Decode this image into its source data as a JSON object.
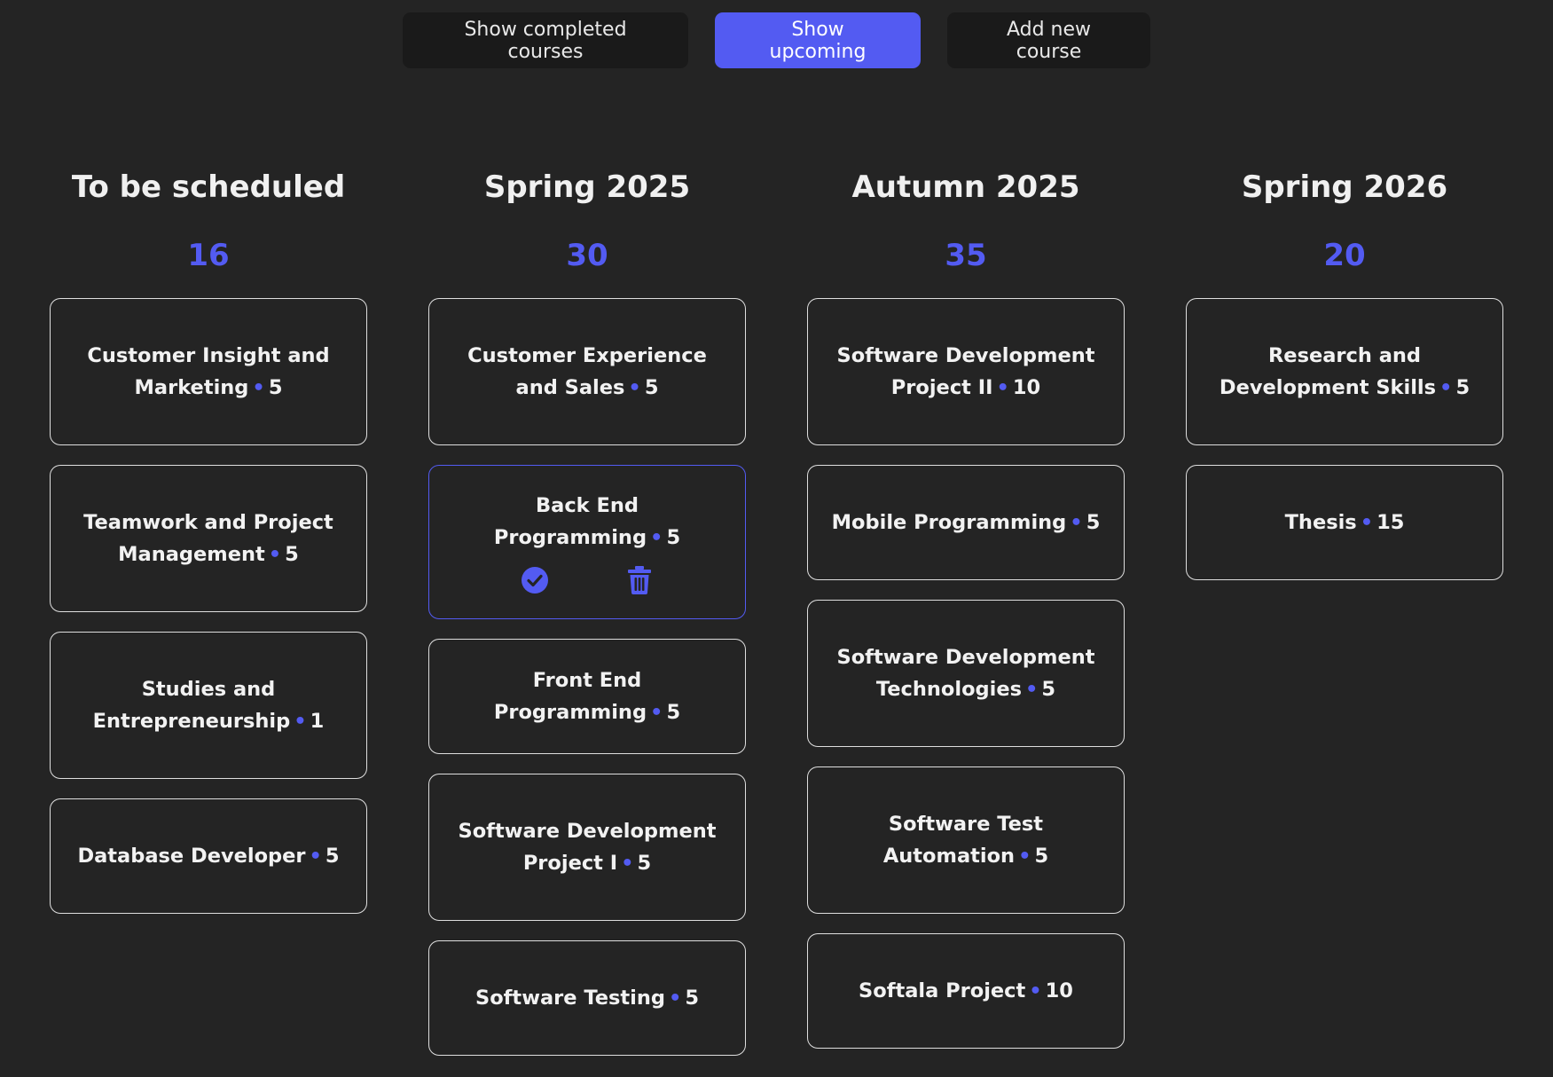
{
  "toolbar": {
    "completed_label": "Show completed courses",
    "upcoming_label": "Show upcoming",
    "add_label": "Add new course"
  },
  "colors": {
    "background": "#242424",
    "accent": "#535bf2",
    "button_bg": "#1a1a1a"
  },
  "columns": [
    {
      "title": "To be scheduled",
      "credits": "16",
      "courses": [
        {
          "name": "Customer Insight and Marketing",
          "credits": "5"
        },
        {
          "name": "Teamwork and Project Management",
          "credits": "5"
        },
        {
          "name": "Studies and Entrepreneurship",
          "credits": "1"
        },
        {
          "name": "Database Developer",
          "credits": "5"
        }
      ]
    },
    {
      "title": "Spring 2025",
      "credits": "30",
      "courses": [
        {
          "name": "Customer Experience and Sales",
          "credits": "5"
        },
        {
          "name": "Back End Programming",
          "credits": "5"
        },
        {
          "name": "Front End Programming",
          "credits": "5"
        },
        {
          "name": "Software Development Project I",
          "credits": "5"
        },
        {
          "name": "Software Testing",
          "credits": "5"
        }
      ]
    },
    {
      "title": "Autumn 2025",
      "credits": "35",
      "courses": [
        {
          "name": "Software Development Project II",
          "credits": "10"
        },
        {
          "name": "Mobile Programming",
          "credits": "5"
        },
        {
          "name": "Software Development Technologies",
          "credits": "5"
        },
        {
          "name": "Software Test Automation",
          "credits": "5"
        },
        {
          "name": "Softala Project",
          "credits": "10"
        }
      ]
    },
    {
      "title": "Spring 2026",
      "credits": "20",
      "courses": [
        {
          "name": "Research and Development Skills",
          "credits": "5"
        },
        {
          "name": "Thesis",
          "credits": "15"
        }
      ]
    }
  ],
  "selected_card_icons": [
    "check-circle-icon",
    "trash-icon"
  ],
  "separator": "•"
}
